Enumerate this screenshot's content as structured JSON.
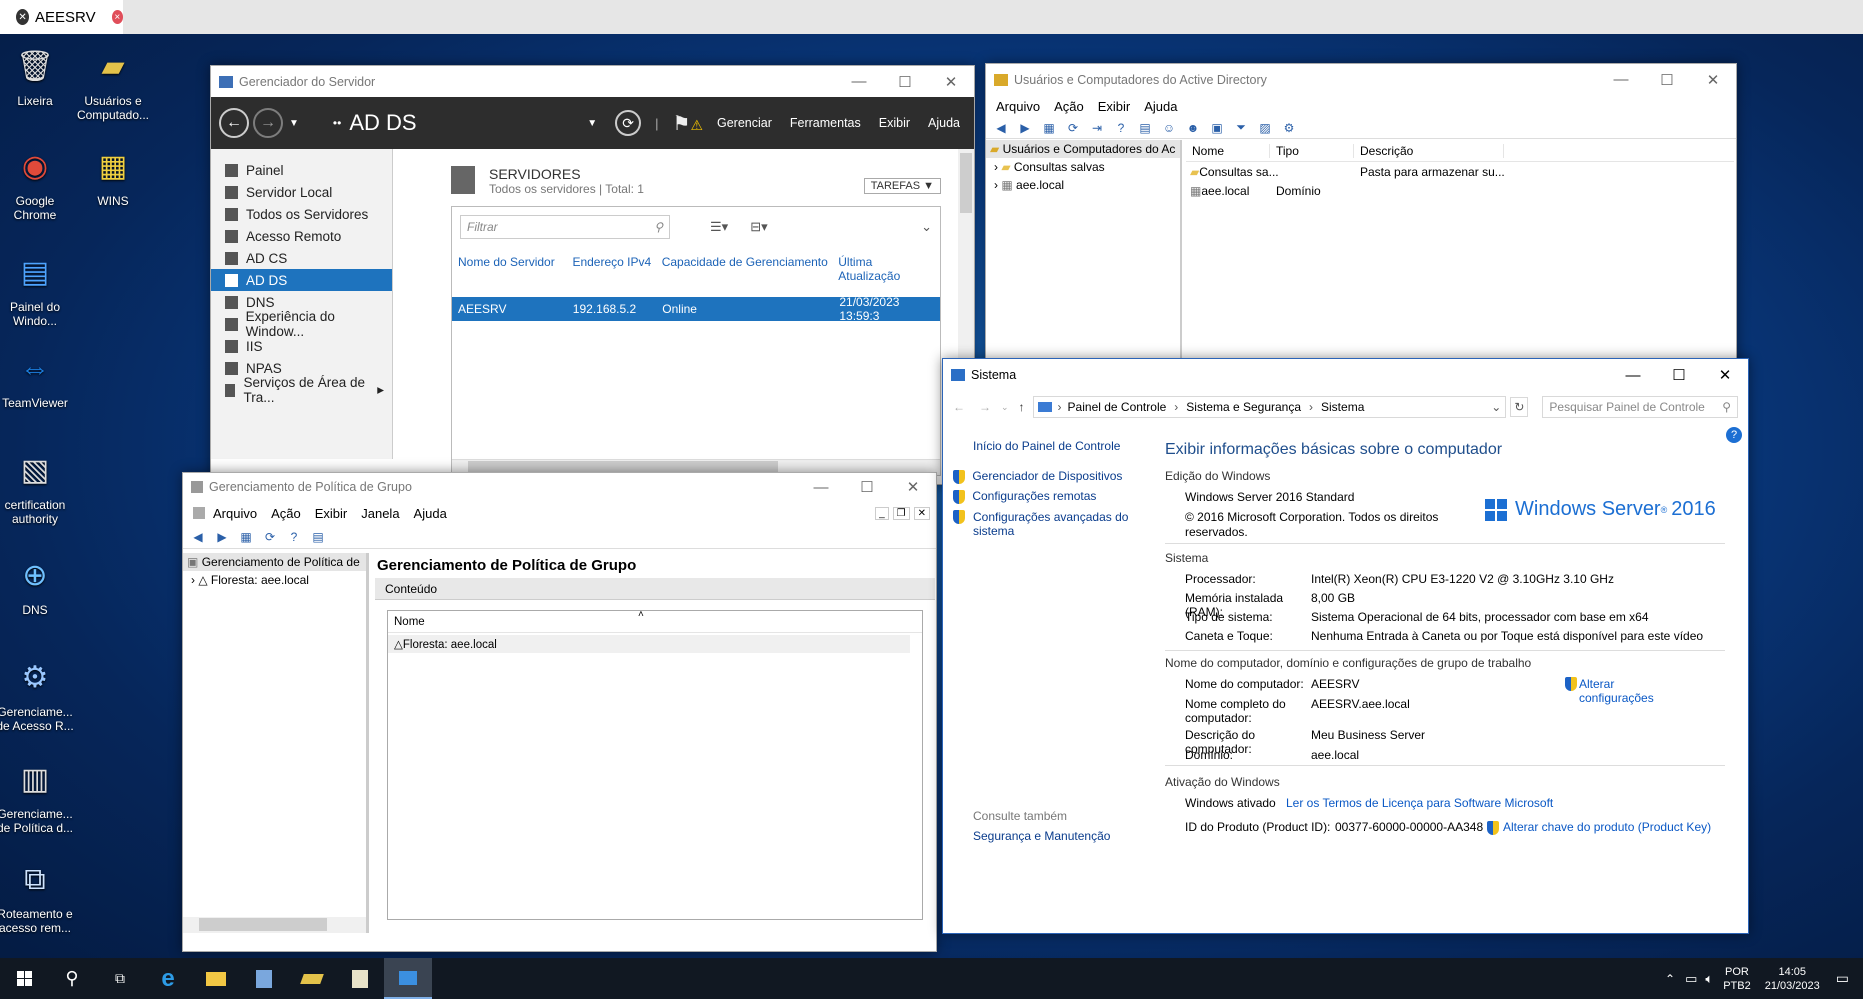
{
  "remote_tab": {
    "title": "AEESRV"
  },
  "desktop_icons": [
    {
      "label": "Lixeira",
      "icon": "recycle-bin-icon"
    },
    {
      "label": "Usuários e Computado...",
      "icon": "ad-users-icon"
    },
    {
      "label": "Google Chrome",
      "icon": "chrome-icon"
    },
    {
      "label": "WINS",
      "icon": "wins-icon"
    },
    {
      "label": "Painel do Windo...",
      "icon": "admin-center-icon"
    },
    {
      "label": "TeamViewer",
      "icon": "teamviewer-icon"
    },
    {
      "label": "certification authority",
      "icon": "certification-authority-icon"
    },
    {
      "label": "DNS",
      "icon": "dns-icon"
    },
    {
      "label": "Gerenciame... de Acesso R...",
      "icon": "remote-access-mgmt-icon"
    },
    {
      "label": "Gerenciame... de Política d...",
      "icon": "gpo-mgmt-icon"
    },
    {
      "label": "Roteamento e acesso rem...",
      "icon": "routing-icon"
    }
  ],
  "server_manager": {
    "title": "Gerenciador do Servidor",
    "breadcrumb_prefix": "••",
    "breadcrumb": "AD DS",
    "menu": [
      "Gerenciar",
      "Ferramentas",
      "Exibir",
      "Ajuda"
    ],
    "sidebar": [
      "Painel",
      "Servidor Local",
      "Todos os Servidores",
      "Acesso Remoto",
      "AD CS",
      "AD DS",
      "DNS",
      "Experiência do Window...",
      "IIS",
      "NPAS",
      "Serviços de Área de Tra..."
    ],
    "selected_index": 5,
    "servers_title": "SERVIDORES",
    "servers_subtitle": "Todos os servidores | Total: 1",
    "tasks_label": "TAREFAS",
    "filter_placeholder": "Filtrar",
    "columns": [
      "Nome do Servidor",
      "Endereço IPv4",
      "Capacidade de Gerenciamento",
      "Última Atualização"
    ],
    "rows": [
      [
        "AEESRV",
        "192.168.5.2",
        "Online",
        "21/03/2023 13:59:3"
      ]
    ]
  },
  "ad_users": {
    "title": "Usuários e Computadores do Active Directory",
    "menu": [
      "Arquivo",
      "Ação",
      "Exibir",
      "Ajuda"
    ],
    "tree_root": "Usuários e Computadores do Ac",
    "tree": [
      "Consultas salvas",
      "aee.local"
    ],
    "columns": [
      "Nome",
      "Tipo",
      "Descrição"
    ],
    "rows": [
      [
        "Consultas sa...",
        "",
        "Pasta para armazenar su..."
      ],
      [
        "aee.local",
        "Domínio",
        ""
      ]
    ]
  },
  "gpo": {
    "title": "Gerenciamento de Política de Grupo",
    "menu": [
      "Arquivo",
      "Ação",
      "Exibir",
      "Janela",
      "Ajuda"
    ],
    "tree_root": "Gerenciamento de Política de",
    "tree": [
      "Floresta: aee.local"
    ],
    "heading": "Gerenciamento de Política de Grupo",
    "tab": "Conteúdo",
    "column": "Nome",
    "rows": [
      "Floresta: aee.local"
    ]
  },
  "sistema": {
    "title": "Sistema",
    "breadcrumb": [
      "Painel de Controle",
      "Sistema e Segurança",
      "Sistema"
    ],
    "search_placeholder": "Pesquisar Painel de Controle",
    "left_home": "Início do Painel de Controle",
    "left_links": [
      "Gerenciador de Dispositivos",
      "Configurações remotas",
      "Configurações avançadas do sistema"
    ],
    "see_also": "Consulte também",
    "see_also_link": "Segurança e Manutenção",
    "heading": "Exibir informações básicas sobre o computador",
    "edition_title": "Edição do Windows",
    "edition": "Windows Server 2016 Standard",
    "copyright": "© 2016 Microsoft Corporation. Todos os direitos reservados.",
    "logo_text": "Windows Server",
    "logo_year": "2016",
    "system_title": "Sistema",
    "system_rows": [
      [
        "Processador:",
        "Intel(R) Xeon(R) CPU E3-1220 V2 @ 3.10GHz   3.10 GHz"
      ],
      [
        "Memória instalada (RAM):",
        "8,00 GB"
      ],
      [
        "Tipo de sistema:",
        "Sistema Operacional de 64 bits, processador com base em x64"
      ],
      [
        "Caneta e Toque:",
        "Nenhuma Entrada à Caneta ou por Toque está disponível para este vídeo"
      ]
    ],
    "computer_title": "Nome do computador, domínio e configurações de grupo de trabalho",
    "computer_rows": [
      [
        "Nome do computador:",
        "AEESRV"
      ],
      [
        "Nome completo do computador:",
        "AEESRV.aee.local"
      ],
      [
        "Descrição do computador:",
        "Meu Business Server"
      ],
      [
        "Domínio:",
        "aee.local"
      ]
    ],
    "change_settings": "Alterar configurações",
    "activation_title": "Ativação do Windows",
    "activated": "Windows ativado",
    "license_link": "Ler os Termos de Licença para Software Microsoft",
    "product_id_label": "ID do Produto (Product ID):",
    "product_id": "00377-60000-00000-AA348",
    "change_key": "Alterar chave do produto (Product Key)"
  },
  "taskbar": {
    "lang1": "POR",
    "lang2": "PTB2",
    "time": "14:05",
    "date": "21/03/2023"
  }
}
